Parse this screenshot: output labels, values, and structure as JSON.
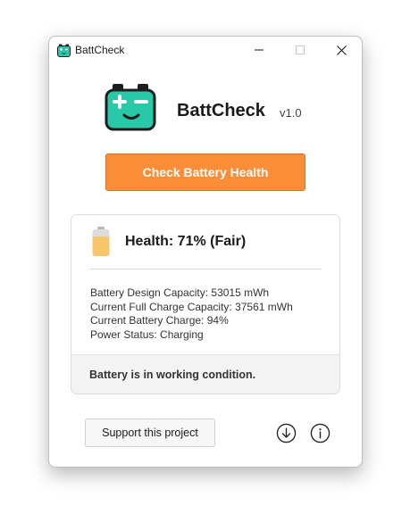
{
  "window": {
    "title": "BattCheck",
    "controls": [
      "minimize",
      "maximize",
      "close"
    ]
  },
  "header": {
    "app_name": "BattCheck",
    "version": "v1.0",
    "logo_icon": "battery-face-icon",
    "accent_color": "#27c9a8"
  },
  "primary_button": {
    "label": "Check Battery Health",
    "color": "#f98d38"
  },
  "result": {
    "health_label": "Health: 71% (Fair)",
    "health_percent": 71,
    "battery_icon_color": "#f8c66a",
    "details": [
      "Battery Design Capacity: 53015 mWh",
      "Current Full Charge Capacity: 37561 mWh",
      "Current Battery Charge: 94%",
      "Power Status: Charging"
    ],
    "status": "Battery is in working condition."
  },
  "footer": {
    "support_label": "Support this project",
    "icons": [
      "download-icon",
      "info-icon"
    ]
  }
}
